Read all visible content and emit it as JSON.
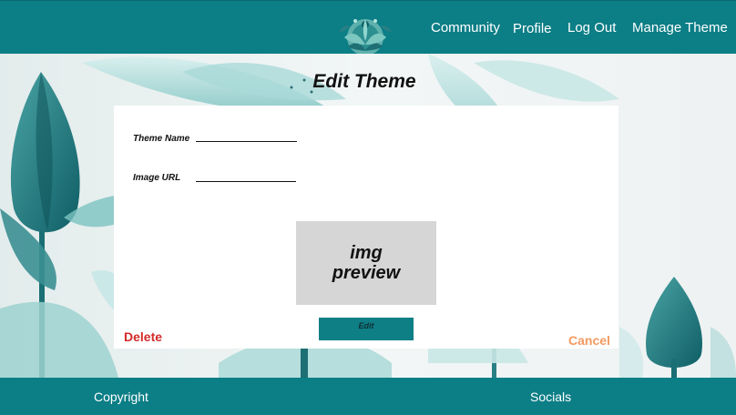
{
  "nav": {
    "community": "Community",
    "profile": "Profile",
    "logout": "Log Out",
    "manage_theme": "Manage Theme"
  },
  "page": {
    "title": "Edit Theme"
  },
  "form": {
    "theme_name_label": "Theme Name",
    "image_url_label": "Image URL",
    "preview_text_line1": "img",
    "preview_text_line2": "preview",
    "edit_label": "Edit",
    "delete_label": "Delete",
    "cancel_label": "Cancel"
  },
  "footer": {
    "copyright": "Copyright",
    "socials": "Socials"
  },
  "colors": {
    "primary": "#0c7e86",
    "delete": "#d42a2a",
    "cancel": "#f39a61",
    "preview_bg": "#d6d6d6"
  },
  "icons": {
    "logo": "lotus-logo-icon"
  }
}
